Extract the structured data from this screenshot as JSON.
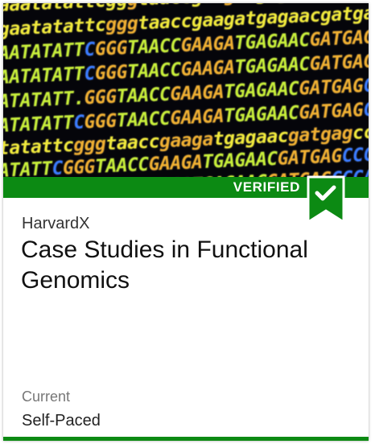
{
  "card": {
    "badge": "VERIFIED",
    "organization": "HarvardX",
    "title": "Case Studies in Functional Genomics",
    "status": "Current",
    "pacing": "Self-Paced",
    "accent_color": "#0c8a13",
    "ribbon_icon": "checkmark-icon"
  }
}
